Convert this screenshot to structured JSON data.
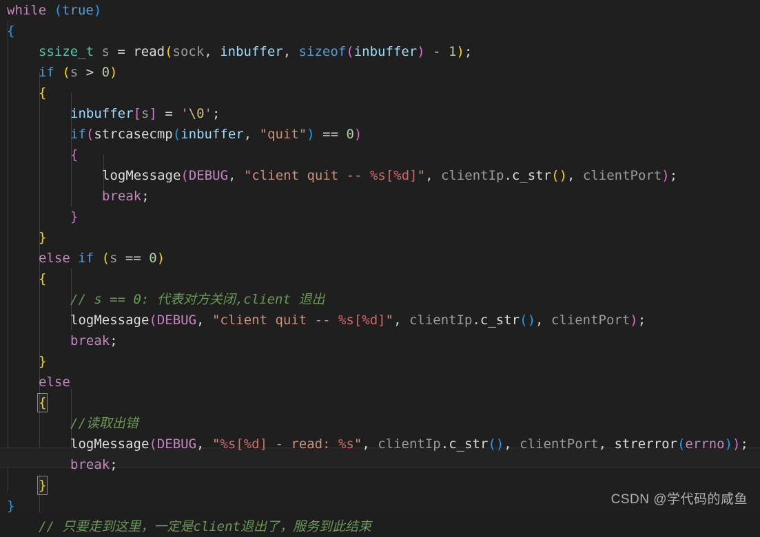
{
  "editor": {
    "language": "cpp",
    "background_color": "#1f1f1f",
    "active_line_color": "#232323",
    "theme": "dark-plus",
    "font_size_px": 19,
    "line_height_px": 30
  },
  "colors": {
    "keyword_blue": "#569cd6",
    "keyword_purple": "#c586c0",
    "type_teal": "#4ec9b0",
    "variable_lightblue": "#9cdcfe",
    "plain_text": "#d4d4d4",
    "dim_param": "#9b9b9b",
    "number_green": "#b5cea8",
    "string_orange": "#ce9178",
    "format_spec": "#d16969",
    "escape_tan": "#d7ba7d",
    "comment_green": "#6a9955",
    "bracket_yellow": "#ffd700",
    "bracket_magenta": "#da70d6",
    "bracket_blue": "#179fff"
  },
  "code": {
    "lines": [
      {
        "n": 1,
        "indent": 0,
        "text": "while (true)"
      },
      {
        "n": 2,
        "indent": 0,
        "text": "{"
      },
      {
        "n": 3,
        "indent": 1,
        "text": "ssize_t s = read(sock, inbuffer, sizeof(inbuffer) - 1);"
      },
      {
        "n": 4,
        "indent": 1,
        "text": "if (s > 0)"
      },
      {
        "n": 5,
        "indent": 1,
        "text": "{"
      },
      {
        "n": 6,
        "indent": 2,
        "text": "inbuffer[s] = '\\0';"
      },
      {
        "n": 7,
        "indent": 2,
        "text": "if(strcasecmp(inbuffer, \"quit\") == 0)"
      },
      {
        "n": 8,
        "indent": 2,
        "text": "{"
      },
      {
        "n": 9,
        "indent": 3,
        "text": "logMessage(DEBUG, \"client quit -- %s[%d]\", clientIp.c_str(), clientPort);"
      },
      {
        "n": 10,
        "indent": 3,
        "text": "break;"
      },
      {
        "n": 11,
        "indent": 2,
        "text": "}"
      },
      {
        "n": 12,
        "indent": 1,
        "text": "}"
      },
      {
        "n": 13,
        "indent": 1,
        "text": "else if (s == 0)"
      },
      {
        "n": 14,
        "indent": 1,
        "text": "{"
      },
      {
        "n": 15,
        "indent": 2,
        "text": "// s == 0: 代表对方关闭,client 退出"
      },
      {
        "n": 16,
        "indent": 2,
        "text": "logMessage(DEBUG, \"client quit -- %s[%d]\", clientIp.c_str(), clientPort);"
      },
      {
        "n": 17,
        "indent": 2,
        "text": "break;"
      },
      {
        "n": 18,
        "indent": 1,
        "text": "}"
      },
      {
        "n": 19,
        "indent": 1,
        "text": "else"
      },
      {
        "n": 20,
        "indent": 1,
        "text": "{"
      },
      {
        "n": 21,
        "indent": 2,
        "text": "//读取出错"
      },
      {
        "n": 22,
        "indent": 2,
        "text": "logMessage(DEBUG, \"%s[%d] - read: %s\", clientIp.c_str(), clientPort, strerror(errno));"
      },
      {
        "n": 23,
        "indent": 2,
        "text": "break;"
      },
      {
        "n": 24,
        "indent": 1,
        "text": "}"
      },
      {
        "n": 25,
        "indent": 0,
        "text": "}"
      },
      {
        "n": 26,
        "indent": 1,
        "text": "// 只要走到这里，一定是client退出了，服务到此结束"
      }
    ],
    "tokens": {
      "while": "while",
      "true": "true",
      "ssize_t": "ssize_t",
      "s": "s",
      "read": "read",
      "sock": "sock",
      "inbuffer": "inbuffer",
      "sizeof": "sizeof",
      "if": "if",
      "else": "else",
      "break": "break",
      "strcasecmp": "strcasecmp",
      "logMessage": "logMessage",
      "DEBUG": "DEBUG",
      "clientIp": "clientIp",
      "c_str": "c_str",
      "clientPort": "clientPort",
      "strerror": "strerror",
      "errno": "errno",
      "quit_string": "\"quit\"",
      "null_char": "'\\0'",
      "str_client_quit": "\"client quit -- %s[%d]\"",
      "str_read_err": "\"%s[%d] - read: %s\"",
      "zero": "0",
      "one": "1"
    },
    "comments": {
      "c15": "// s == 0: 代表对方关闭,client 退出",
      "c21": "//读取出错",
      "c26": "// 只要走到这里，一定是client退出了，服务到此结束"
    }
  },
  "watermark": {
    "text": "CSDN @学代码的咸鱼"
  }
}
